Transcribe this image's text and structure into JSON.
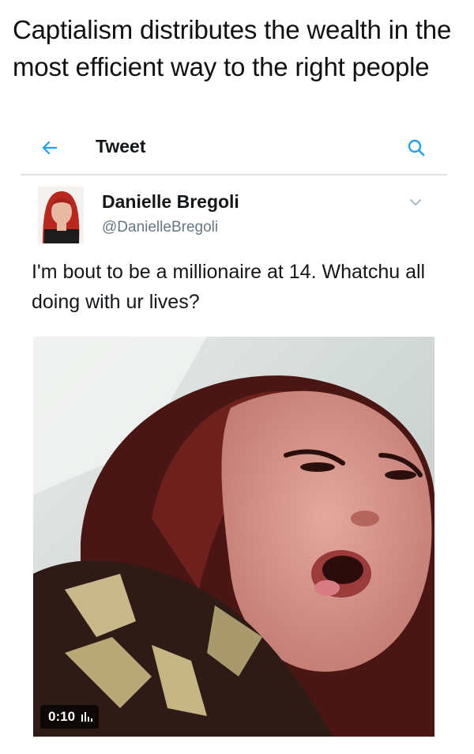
{
  "caption": "Captialism distributes the wealth in the most efficient way to the right people",
  "topbar": {
    "title": "Tweet",
    "back_icon": "arrow-left-icon",
    "search_icon": "search-icon"
  },
  "tweet": {
    "author_name": "Danielle Bregoli",
    "author_handle": "@DanielleBregoli",
    "text": "I'm bout to be a millionaire at 14. Whatchu all doing with ur lives?",
    "media": {
      "type": "video",
      "duration": "0:10"
    }
  },
  "colors": {
    "accent": "#1da1f2",
    "name": "#14171a",
    "muted": "#657786",
    "divider": "#dfe3e6"
  }
}
